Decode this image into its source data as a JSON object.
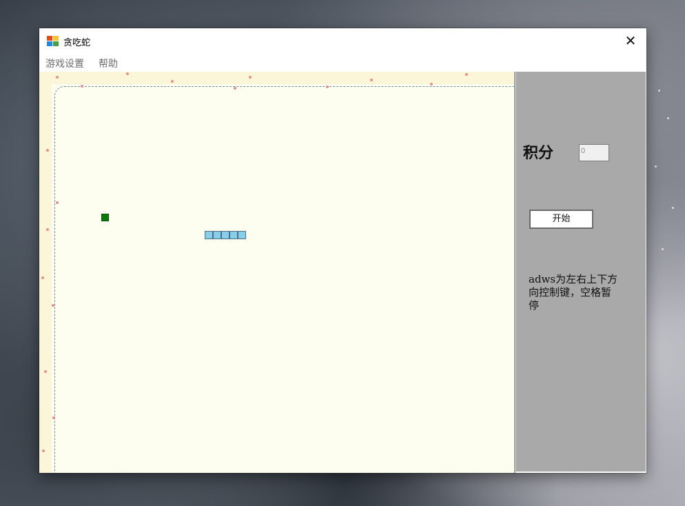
{
  "window": {
    "title": "贪吃蛇",
    "close_glyph": "✕"
  },
  "menu": {
    "items": [
      "游戏设置",
      "帮助"
    ]
  },
  "game": {
    "snake_segments": 5,
    "food_color": "#0a7a0a",
    "snake_color": "#87ceeb"
  },
  "panel": {
    "score_label": "积分",
    "score_value": "0",
    "start_label": "开始",
    "help_text": "adws为左右上下方向控制键，空格暂停"
  },
  "colors": {
    "panel_bg": "#a9a9a9",
    "game_bg": "#fdfdf0"
  }
}
